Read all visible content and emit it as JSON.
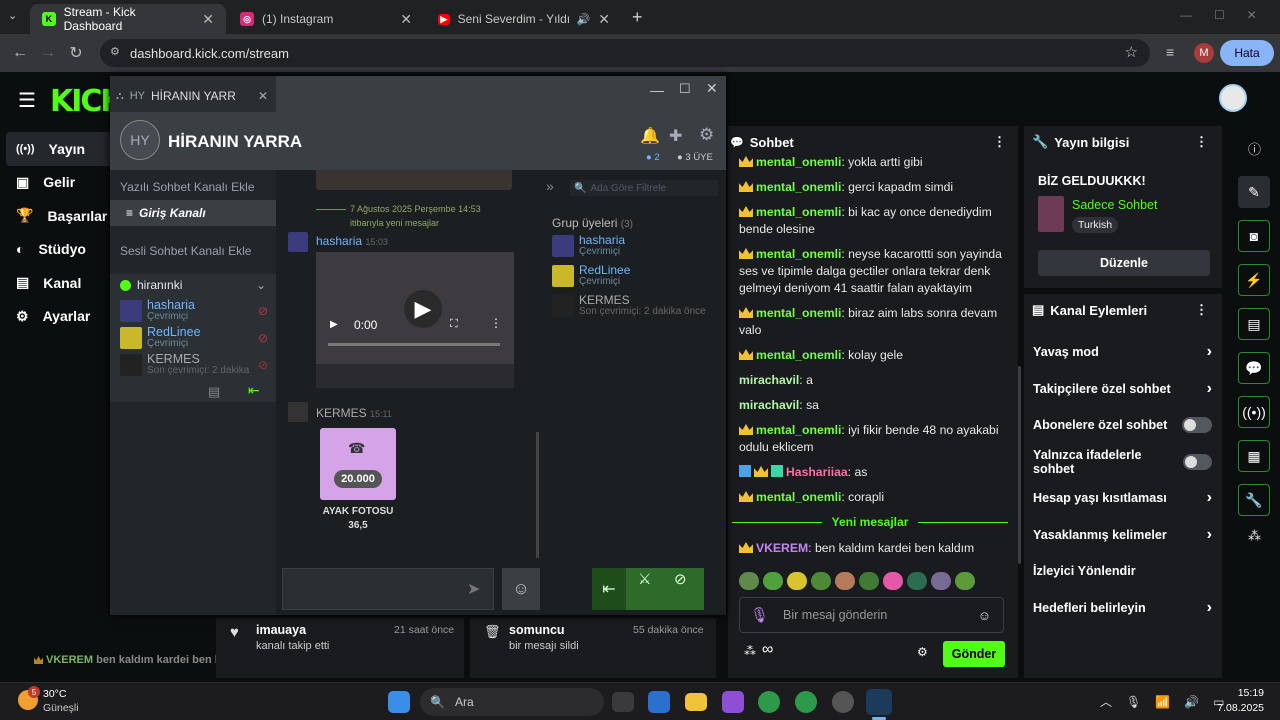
{
  "browser": {
    "tabs": [
      {
        "title": "Stream - Kick Dashboard",
        "icon": "kick-icon"
      },
      {
        "title": "(1) Instagram",
        "icon": "instagram-icon"
      },
      {
        "title": "Seni Severdim - Yıldız Usmo",
        "icon": "youtube-icon"
      }
    ],
    "url": "dashboard.kick.com/stream",
    "profile_initial": "M",
    "error_badge": "Hata"
  },
  "kick": {
    "logo": "KICK",
    "nav": [
      {
        "label": "Yayın",
        "icon": "broadcast-icon"
      },
      {
        "label": "Gelir",
        "icon": "revenue-icon"
      },
      {
        "label": "Başarılar",
        "icon": "trophy-icon"
      },
      {
        "label": "Stüdyo",
        "icon": "palette-icon"
      },
      {
        "label": "Kanal",
        "icon": "channel-icon"
      },
      {
        "label": "Ayarlar",
        "icon": "settings-icon"
      }
    ],
    "overlay_message": {
      "user": "VKEREM",
      "text": "ben kaldım kardei ben kaldım"
    }
  },
  "chat": {
    "title": "Sohbet",
    "messages": [
      {
        "user": "mental_onemli",
        "badge": true,
        "text": "yokla artti gibi"
      },
      {
        "user": "mental_onemli",
        "badge": true,
        "text": "gerci kapadm simdi"
      },
      {
        "user": "mental_onemli",
        "badge": true,
        "text": "bi kac ay once denediydim bende olesine"
      },
      {
        "user": "mental_onemli",
        "badge": true,
        "text": "neyse kacarottti son yayinda ses ve tipimle dalga gectiler onlara tekrar denk gelmeyi deniyom 41 saattir falan ayaktayim"
      },
      {
        "user": "mental_onemli",
        "badge": true,
        "text": "biraz aim labs sonra devam valo"
      },
      {
        "user": "mental_onemli",
        "badge": true,
        "text": "kolay gele"
      },
      {
        "user": "mirachavil",
        "badge": false,
        "text": "a"
      },
      {
        "user": "mirachavil",
        "badge": false,
        "text": "sa"
      },
      {
        "user": "mental_onemli",
        "badge": true,
        "text": "iyi fikir bende 48 no ayakabi odulu eklicem"
      },
      {
        "user": "Hashariiaa",
        "badge": true,
        "text": "as",
        "pink": true
      },
      {
        "user": "mental_onemli",
        "badge": true,
        "text": "corapli"
      }
    ],
    "new_messages_label": "Yeni mesajlar",
    "new_message": {
      "user": "VKEREM",
      "text": "ben kaldım kardei ben kaldım"
    },
    "input_placeholder": "Bir mesaj gönderin",
    "send_label": "Gönder",
    "infinity": "∞"
  },
  "stream_info": {
    "title": "Yayın bilgisi",
    "stream_title": "BİZ GELDUUKKK!",
    "category": "Sadece Sohbet",
    "language": "Turkish",
    "edit_label": "Düzenle"
  },
  "channel_actions": {
    "title": "Kanal Eylemleri",
    "items": [
      {
        "label": "Yavaş mod",
        "kind": "chevron"
      },
      {
        "label": "Takipçilere özel sohbet",
        "kind": "chevron"
      },
      {
        "label": "Abonelere özel sohbet",
        "kind": "toggle",
        "on": false
      },
      {
        "label": "Yalnızca ifadelerle sohbet",
        "kind": "toggle",
        "on": false
      },
      {
        "label": "Hesap yaşı kısıtlaması",
        "kind": "chevron"
      },
      {
        "label": "Yasaklanmış kelimeler",
        "kind": "chevron"
      },
      {
        "label": "İzleyici Yönlendir",
        "kind": "none"
      },
      {
        "label": "Hedefleri belirleyin",
        "kind": "chevron"
      }
    ]
  },
  "feed": [
    {
      "user": "imauaya",
      "time": "21 saat önce",
      "text": "kanalı takip etti",
      "icon": "heart-icon"
    },
    {
      "user": "somuncu",
      "time": "55 dakika önce",
      "text": "bir mesajı sildi",
      "icon": "trash-icon"
    }
  ],
  "steam": {
    "tab_initials": "HY",
    "tab_title": "HİRANIN YARRA",
    "group_title": "HİRANIN YARRA",
    "online_count": "2",
    "member_count": "3 ÜYE",
    "text_channel_add": "Yazılı Sohbet Kanalı Ekle",
    "entry_channel": "Giriş Kanalı",
    "voice_channel_add": "Sesli Sohbet Kanalı Ekle",
    "voice_room": "hiranınki",
    "voice_members": [
      {
        "name": "hasharia",
        "status": "Çevrimiçi"
      },
      {
        "name": "RedLinee",
        "status": "Çevrimiçi"
      },
      {
        "name": "KERMES",
        "status": "Son çevrimiçi: 2 dakika"
      }
    ],
    "date_divider": "7 Ağustos 2025 Perşembe 14:53",
    "date_sub": "itibarıyla yeni mesajlar",
    "msg1": {
      "user": "hasharia",
      "time": "15:03"
    },
    "video_time": "0:00",
    "msg2": {
      "user": "KERMES",
      "time": "15:11"
    },
    "item": {
      "price": "20.000",
      "name": "AYAK FOTOSU",
      "value": "36,5"
    },
    "filter_placeholder": "Ada Göre Filtrele",
    "members_header": "Grup üyeleri",
    "members_count": "(3)",
    "members": [
      {
        "name": "hasharia",
        "status": "Çevrimiçi"
      },
      {
        "name": "RedLinee",
        "status": "Çevrimiçi"
      },
      {
        "name": "KERMES",
        "status": "Son çevrimiçi: 2 dakika önce"
      }
    ]
  },
  "taskbar": {
    "weather_temp": "30°C",
    "weather_text": "Güneşli",
    "weather_badge": "5",
    "search": "Ara",
    "time": "15:19",
    "date": "7.08.2025"
  }
}
